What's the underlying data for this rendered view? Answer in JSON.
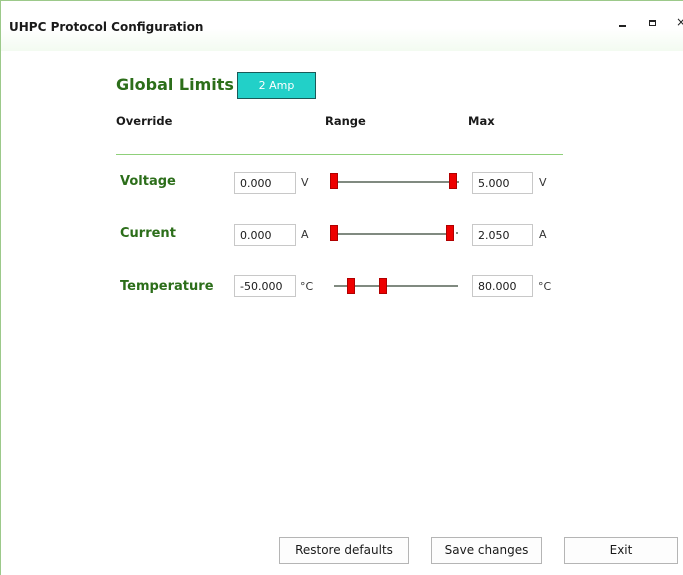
{
  "window": {
    "title": "UHPC Protocol Configuration",
    "controls": [
      "minimize-icon",
      "maximize-icon",
      "close-icon"
    ],
    "close_glyph": "×"
  },
  "section": {
    "title": "Global Limits",
    "mode_button": "2 Amp",
    "accent_color": "#22d0c8",
    "label_color": "#2c6e1a"
  },
  "columns": {
    "override": "Override",
    "range": "Range",
    "max": "Max"
  },
  "rows": [
    {
      "label": "Voltage",
      "min": "0.000",
      "min_unit": "V",
      "max": "5.000",
      "max_unit": "V"
    },
    {
      "label": "Current",
      "min": "0.000",
      "min_unit": "A",
      "max": "2.050",
      "max_unit": "A"
    },
    {
      "label": "Temperature",
      "min": "-50.000",
      "min_unit": "°C",
      "max": "80.000",
      "max_unit": "°C"
    }
  ],
  "buttons": {
    "restore": "Restore defaults",
    "save": "Save changes",
    "exit": "Exit"
  }
}
